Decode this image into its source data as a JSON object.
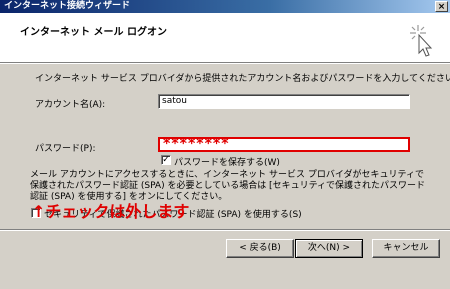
{
  "window": {
    "title": "インターネット接続ウィザード",
    "close_glyph": "×"
  },
  "header": {
    "title": "インターネット メール ログオン",
    "icon": "wizard-wand-icon"
  },
  "intro": "インターネット サービス プロバイダから提供されたアカウント名およびパスワードを入力してください。",
  "account": {
    "label": "アカウント名(A):",
    "value": "satou"
  },
  "password": {
    "label": "パスワード(P):",
    "value": "********"
  },
  "save_password": {
    "label": "パスワードを保存する(W)",
    "checked": true,
    "mark": "✓"
  },
  "spa_note": "メール アカウントにアクセスするときに、インターネット サービス プロバイダがセキュリティで保護されたパスワード認証 (SPA) を必要としている場合は [セキュリティで保護されたパスワード認証 (SPA) を使用する] をオンにしてください。",
  "spa_checkbox": {
    "label": "セキュリティで保護されたパスワード認証 (SPA) を使用する(S)",
    "checked": false
  },
  "annotation": "↑チェックは外します",
  "buttons": {
    "back": "< 戻る(B)",
    "next": "次へ(N) >",
    "cancel": "キャンセル"
  },
  "colors": {
    "annotation": "#e00000",
    "titlebar": "#0a246a",
    "dialog": "#d4d0c8"
  }
}
